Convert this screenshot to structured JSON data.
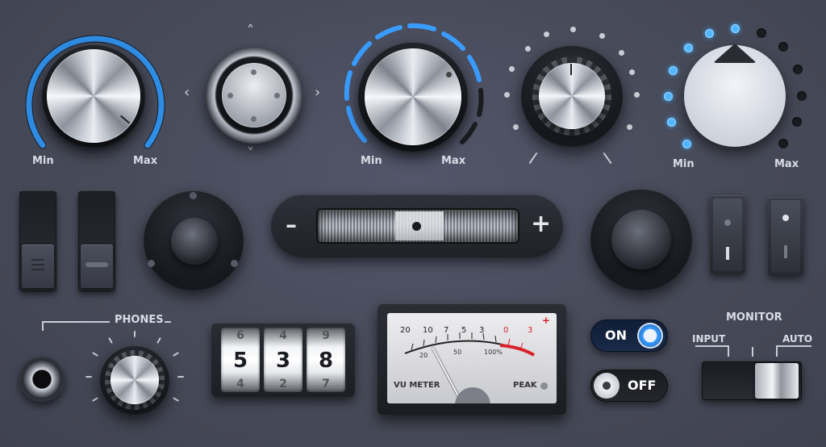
{
  "knob1": {
    "min_label": "Min",
    "max_label": "Max",
    "level": 0.72
  },
  "knob3": {
    "min_label": "Min",
    "max_label": "Max"
  },
  "knob5": {
    "min_label": "Min",
    "max_label": "Max",
    "lit_leds": 6
  },
  "fader": {
    "minus_label": "–",
    "plus_label": "+"
  },
  "phones": {
    "label": "PHONES"
  },
  "counter": {
    "digits": [
      {
        "top": "6",
        "value": "5",
        "bottom": "4"
      },
      {
        "top": "4",
        "value": "3",
        "bottom": "2"
      },
      {
        "top": "9",
        "value": "8",
        "bottom": "7"
      }
    ]
  },
  "vu_meter": {
    "label": "VU METER",
    "peak_label": "PEAK",
    "plus_mark": "+",
    "scale_top": [
      "20",
      "10",
      "7",
      "5",
      "3",
      "0",
      "3"
    ],
    "scale_bottom": [
      "20",
      "50",
      "100%"
    ]
  },
  "switches": {
    "on_label": "ON",
    "off_label": "OFF"
  },
  "monitor": {
    "title": "MONITOR",
    "input_label": "INPUT",
    "auto_label": "AUTO"
  },
  "colors": {
    "accent_blue": "#3aa6ff",
    "peak_red": "#d8232a",
    "panel": "#4a4d5a"
  }
}
